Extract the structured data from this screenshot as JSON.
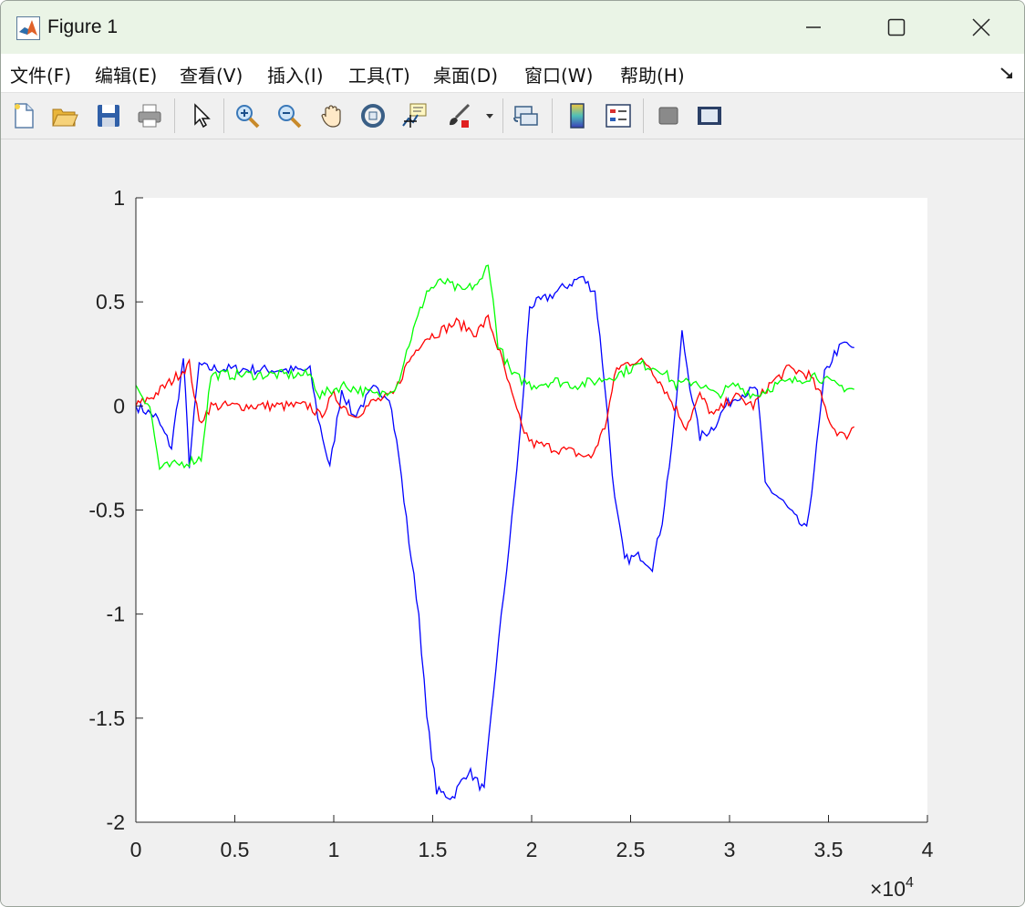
{
  "window": {
    "title": "Figure 1"
  },
  "menu": {
    "items": [
      {
        "label": "文件(F)"
      },
      {
        "label": "编辑(E)"
      },
      {
        "label": "查看(V)"
      },
      {
        "label": "插入(I)"
      },
      {
        "label": "工具(T)"
      },
      {
        "label": "桌面(D)"
      },
      {
        "label": "窗口(W)"
      },
      {
        "label": "帮助(H)"
      }
    ]
  },
  "toolbar": {
    "icons": [
      "new-figure-icon",
      "open-file-icon",
      "save-icon",
      "print-icon",
      "edit-plot-icon",
      "zoom-in-icon",
      "zoom-out-icon",
      "pan-icon",
      "rotate-3d-icon",
      "data-cursor-icon",
      "brush-icon",
      "link-plot-icon",
      "colorbar-icon",
      "legend-icon",
      "hide-plot-tools-icon",
      "show-plot-tools-icon"
    ]
  },
  "chart_data": {
    "type": "line",
    "xlim": [
      0,
      40000
    ],
    "ylim": [
      -2,
      1
    ],
    "x_ticks": [
      "0",
      "0.5",
      "1",
      "1.5",
      "2",
      "2.5",
      "3",
      "3.5",
      "4"
    ],
    "y_ticks": [
      "1",
      "0.5",
      "0",
      "-0.5",
      "-1",
      "-1.5",
      "-2"
    ],
    "x_exponent_label": "×10",
    "x_exponent_power": "4",
    "grid": false,
    "series": [
      {
        "color": "#0000ff",
        "points": [
          [
            0,
            0
          ],
          [
            1000,
            -0.05
          ],
          [
            1800,
            -0.2
          ],
          [
            2400,
            0.23
          ],
          [
            2700,
            -0.28
          ],
          [
            3200,
            0.2
          ],
          [
            3600,
            0.18
          ],
          [
            8800,
            0.17
          ],
          [
            9200,
            -0.05
          ],
          [
            9800,
            -0.3
          ],
          [
            10400,
            0.08
          ],
          [
            11000,
            -0.05
          ],
          [
            12000,
            0.08
          ],
          [
            12800,
            0.05
          ],
          [
            13300,
            -0.25
          ],
          [
            13800,
            -0.65
          ],
          [
            14300,
            -1.0
          ],
          [
            14700,
            -1.5
          ],
          [
            15200,
            -1.85
          ],
          [
            16000,
            -1.88
          ],
          [
            16800,
            -1.75
          ],
          [
            17600,
            -1.85
          ],
          [
            18200,
            -1.25
          ],
          [
            18600,
            -0.9
          ],
          [
            19000,
            -0.55
          ],
          [
            19500,
            -0.05
          ],
          [
            19900,
            0.48
          ],
          [
            20800,
            0.52
          ],
          [
            21800,
            0.58
          ],
          [
            22500,
            0.62
          ],
          [
            23200,
            0.55
          ],
          [
            23700,
            0.1
          ],
          [
            24200,
            -0.45
          ],
          [
            24700,
            -0.74
          ],
          [
            25500,
            -0.72
          ],
          [
            26100,
            -0.77
          ],
          [
            26600,
            -0.55
          ],
          [
            27200,
            -0.1
          ],
          [
            27600,
            0.35
          ],
          [
            28000,
            0.1
          ],
          [
            28500,
            -0.15
          ],
          [
            29200,
            -0.1
          ],
          [
            29800,
            0.0
          ],
          [
            30400,
            0.05
          ],
          [
            31400,
            0.08
          ],
          [
            31800,
            -0.38
          ],
          [
            32600,
            -0.45
          ],
          [
            33400,
            -0.55
          ],
          [
            33900,
            -0.6
          ],
          [
            34400,
            -0.2
          ],
          [
            34800,
            0.15
          ],
          [
            35300,
            0.25
          ],
          [
            35800,
            0.3
          ],
          [
            36300,
            0.28
          ]
        ]
      },
      {
        "color": "#ff0000",
        "points": [
          [
            0,
            0
          ],
          [
            900,
            0.05
          ],
          [
            1800,
            0.12
          ],
          [
            2700,
            0.2
          ],
          [
            3200,
            -0.08
          ],
          [
            3800,
            0.0
          ],
          [
            8800,
            0.0
          ],
          [
            9300,
            -0.05
          ],
          [
            10000,
            0.05
          ],
          [
            11000,
            -0.05
          ],
          [
            12000,
            0.02
          ],
          [
            13000,
            0.05
          ],
          [
            13700,
            0.2
          ],
          [
            14500,
            0.32
          ],
          [
            15200,
            0.35
          ],
          [
            16200,
            0.4
          ],
          [
            17200,
            0.35
          ],
          [
            17800,
            0.42
          ],
          [
            18400,
            0.25
          ],
          [
            19000,
            0.05
          ],
          [
            19500,
            -0.1
          ],
          [
            20000,
            -0.18
          ],
          [
            21000,
            -0.2
          ],
          [
            22000,
            -0.22
          ],
          [
            23000,
            -0.25
          ],
          [
            23700,
            -0.1
          ],
          [
            24300,
            0.18
          ],
          [
            25200,
            0.22
          ],
          [
            25900,
            0.2
          ],
          [
            26600,
            0.1
          ],
          [
            27200,
            0.0
          ],
          [
            27800,
            -0.1
          ],
          [
            28500,
            0.05
          ],
          [
            29200,
            -0.05
          ],
          [
            30200,
            0.05
          ],
          [
            31200,
            0.0
          ],
          [
            32000,
            0.1
          ],
          [
            33000,
            0.18
          ],
          [
            34000,
            0.15
          ],
          [
            34600,
            0.05
          ],
          [
            35200,
            -0.1
          ],
          [
            35800,
            -0.15
          ],
          [
            36300,
            -0.1
          ]
        ]
      },
      {
        "color": "#00ff00",
        "points": [
          [
            0,
            0.1
          ],
          [
            700,
            0.0
          ],
          [
            1200,
            -0.3
          ],
          [
            2200,
            -0.28
          ],
          [
            3300,
            -0.25
          ],
          [
            3800,
            0.15
          ],
          [
            8800,
            0.15
          ],
          [
            9300,
            0.05
          ],
          [
            10500,
            0.1
          ],
          [
            12200,
            0.05
          ],
          [
            13200,
            0.1
          ],
          [
            13800,
            0.3
          ],
          [
            14700,
            0.55
          ],
          [
            15500,
            0.6
          ],
          [
            16500,
            0.55
          ],
          [
            17500,
            0.6
          ],
          [
            17800,
            0.7
          ],
          [
            18300,
            0.3
          ],
          [
            19000,
            0.15
          ],
          [
            20000,
            0.1
          ],
          [
            21200,
            0.12
          ],
          [
            22200,
            0.1
          ],
          [
            23300,
            0.12
          ],
          [
            24300,
            0.15
          ],
          [
            25500,
            0.2
          ],
          [
            26500,
            0.18
          ],
          [
            27300,
            0.1
          ],
          [
            28300,
            0.12
          ],
          [
            29300,
            0.05
          ],
          [
            30300,
            0.1
          ],
          [
            31300,
            0.05
          ],
          [
            32300,
            0.1
          ],
          [
            33300,
            0.12
          ],
          [
            34300,
            0.15
          ],
          [
            35300,
            0.1
          ],
          [
            36300,
            0.08
          ]
        ]
      }
    ]
  }
}
